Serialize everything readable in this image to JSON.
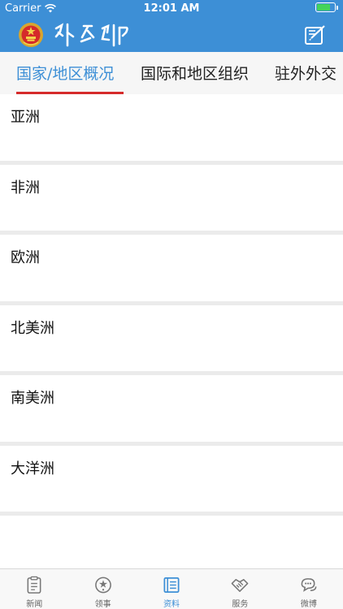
{
  "status_bar": {
    "carrier": "Carrier",
    "time": "12:01 AM",
    "battery_level": 0.7
  },
  "header": {
    "brand_color": "#3d8fd6",
    "emblem_icon": "national-emblem-icon",
    "brand_calligraphy": "外交部",
    "action_icon": "compose-edit-icon"
  },
  "tabs": [
    {
      "label": "国家/地区概况",
      "active": true
    },
    {
      "label": "国际和地区组织",
      "active": false
    },
    {
      "label": "驻外外交",
      "active": false
    }
  ],
  "list": {
    "items": [
      {
        "label": "亚洲"
      },
      {
        "label": "非洲"
      },
      {
        "label": "欧洲"
      },
      {
        "label": "北美洲"
      },
      {
        "label": "南美洲"
      },
      {
        "label": "大洋洲"
      }
    ]
  },
  "tabbar": {
    "items": [
      {
        "label": "新闻",
        "icon": "news-clipboard-icon",
        "active": false
      },
      {
        "label": "领事",
        "icon": "consular-badge-icon",
        "active": false
      },
      {
        "label": "资料",
        "icon": "document-book-icon",
        "active": true
      },
      {
        "label": "服务",
        "icon": "handshake-icon",
        "active": false
      },
      {
        "label": "微博",
        "icon": "weibo-chat-icon",
        "active": false
      }
    ]
  },
  "colors": {
    "accent": "#3d8fd6",
    "tab_indicator": "#d52a2a",
    "separator": "#ebebeb"
  }
}
